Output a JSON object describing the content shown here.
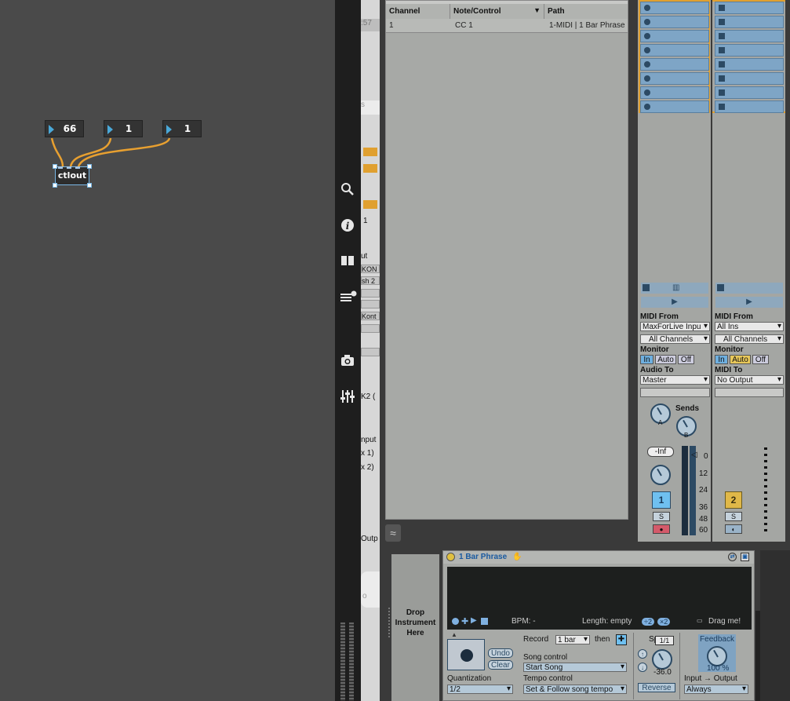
{
  "patcher": {
    "numbers": [
      "66",
      "1",
      "1"
    ],
    "object_label": "ctlout"
  },
  "toolbar": {
    "icons": [
      "search-icon",
      "info-icon",
      "book-icon",
      "list-icon",
      "camera-icon",
      "mixer-icon"
    ]
  },
  "partial_window": {
    "texts": [
      ":57",
      "s",
      "1",
      "ut",
      "KON",
      "sh 2",
      "Kont",
      "K2 (",
      "nput",
      "x 1)",
      "x 2)",
      "Outp",
      "o"
    ]
  },
  "mapping": {
    "headers": [
      "Channel",
      "Note/Control",
      "Path"
    ],
    "rows": [
      {
        "channel": "1",
        "note_control": "CC 1",
        "path": "1-MIDI | 1 Bar Phrase"
      }
    ]
  },
  "tracks": [
    {
      "midi_from_label": "MIDI From",
      "midi_from": "MaxForLive Inpu",
      "channels": "All Channels",
      "monitor_label": "Monitor",
      "monitor": [
        "In",
        "Auto",
        "Off"
      ],
      "out_label": "Audio To",
      "out": "Master",
      "sends_label": "Sends",
      "send_a": "A",
      "send_b": "B",
      "volume": "-Inf",
      "number": "1",
      "solo": "S",
      "scale": [
        "0",
        "12",
        "24",
        "36",
        "48",
        "60"
      ]
    },
    {
      "midi_from_label": "MIDI From",
      "midi_from": "All Ins",
      "channels": "All Channels",
      "monitor_label": "Monitor",
      "monitor": [
        "In",
        "Auto",
        "Off"
      ],
      "out_label": "MIDI To",
      "out": "No Output",
      "number": "2",
      "solo": "S"
    }
  ],
  "device": {
    "drop_text": "Drop Instrument Here",
    "title": "1 Bar Phrase",
    "bpm": "BPM: -",
    "length_label": "Length: empty",
    "length_pills": [
      "÷2",
      "×2"
    ],
    "drag": "Drag me!",
    "undo": "Undo",
    "clear": "Clear",
    "quantization_label": "Quantization",
    "quantization": "1/2",
    "record_label": "Record",
    "record_value": "1 bar",
    "then_label": "then",
    "song_control_label": "Song control",
    "song_control": "Start Song",
    "tempo_control_label": "Tempo control",
    "tempo_control": "Set & Follow song tempo",
    "speed_label": "Sp",
    "speed_badge": "1/1",
    "speed_value": "-36.0",
    "reverse": "Reverse",
    "feedback_label": "Feedback",
    "feedback_value": "100 %",
    "io_label": "Input → Output",
    "io_value": "Always"
  },
  "colors": {
    "accent_blue": "#4aa8d8",
    "clip_blue": "#7ea5c6",
    "orange": "#e0a030",
    "patch_cord": "#e8a030"
  }
}
